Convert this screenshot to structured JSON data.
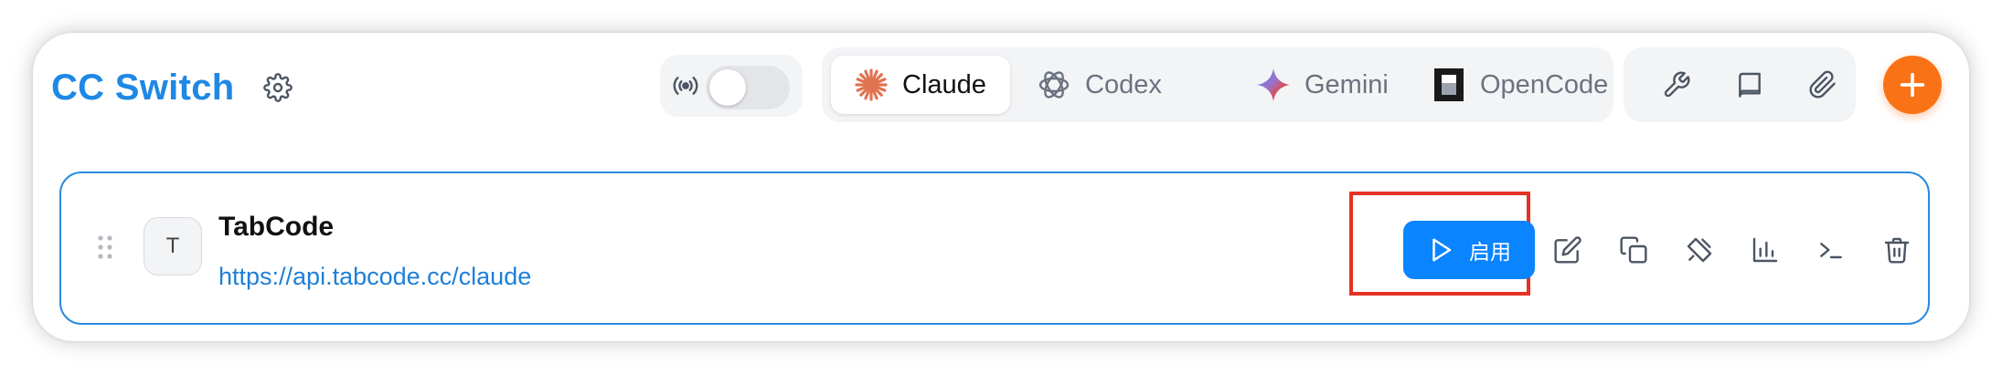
{
  "header": {
    "title": "CC Switch",
    "settings_icon": "gear-icon",
    "proxy_icon": "broadcast-icon",
    "proxy_enabled": false
  },
  "app_tabs": [
    {
      "label": "Claude",
      "icon": "claude-icon",
      "active": true
    },
    {
      "label": "Codex",
      "icon": "codex-icon",
      "active": false
    },
    {
      "label": "Gemini",
      "icon": "gemini-icon",
      "active": false
    },
    {
      "label": "OpenCode",
      "icon": "opencode-icon",
      "active": false
    }
  ],
  "tools": [
    {
      "icon": "wrench-icon"
    },
    {
      "icon": "book-icon"
    },
    {
      "icon": "paperclip-icon"
    }
  ],
  "add_button": {
    "icon": "plus-icon"
  },
  "provider": {
    "avatar_letter": "T",
    "name": "TabCode",
    "url": "https://api.tabcode.cc/claude",
    "enable_label": "启用",
    "actions": [
      "edit-icon",
      "copy-icon",
      "test-icon",
      "usage-icon",
      "terminal-icon",
      "delete-icon"
    ]
  },
  "colors": {
    "accent": "#1e88e5",
    "add_button": "#f97316",
    "enable_button": "#0a84ff",
    "highlight": "#e53222",
    "claude_brand": "#e0734f"
  }
}
